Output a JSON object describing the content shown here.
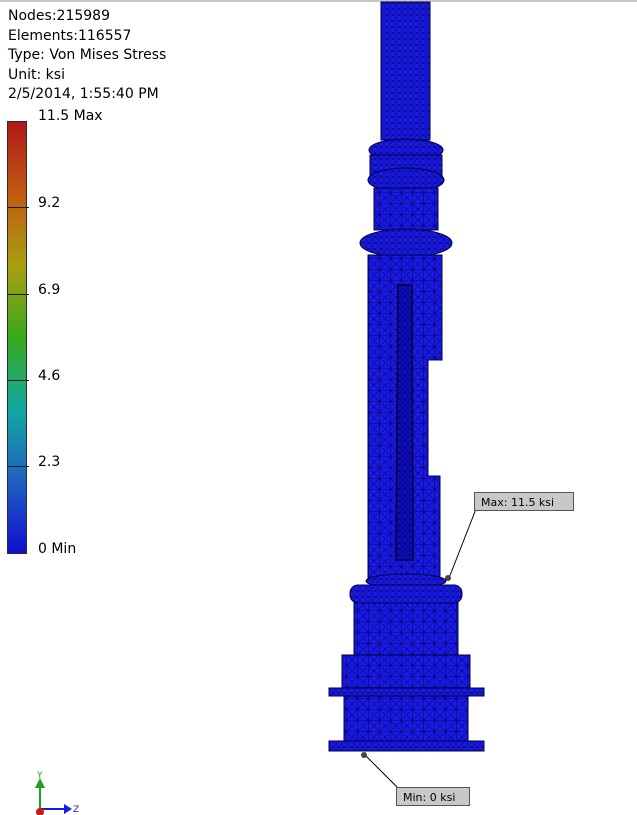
{
  "info": {
    "nodes": "Nodes:215989",
    "elements": "Elements:116557",
    "type": "Type: Von Mises Stress",
    "unit": "Unit: ksi",
    "timestamp": "2/5/2014, 1:55:40 PM"
  },
  "legend": {
    "labels": [
      "11.5 Max",
      "9.2",
      "6.9",
      "4.6",
      "2.3",
      "0 Min"
    ],
    "gradient_colors": [
      "#b01818",
      "#c05a10",
      "#a8a010",
      "#38a81c",
      "#12a8a0",
      "#2060c0",
      "#0f0fcf"
    ]
  },
  "callouts": {
    "max_label": "Max: 11.5 ksi",
    "min_label": "Min: 0 ksi"
  },
  "triad": {
    "y_label": "Y",
    "z_label": "Z"
  },
  "colors": {
    "model_fill": "#1a1ae6",
    "mesh_line": "#000060"
  }
}
